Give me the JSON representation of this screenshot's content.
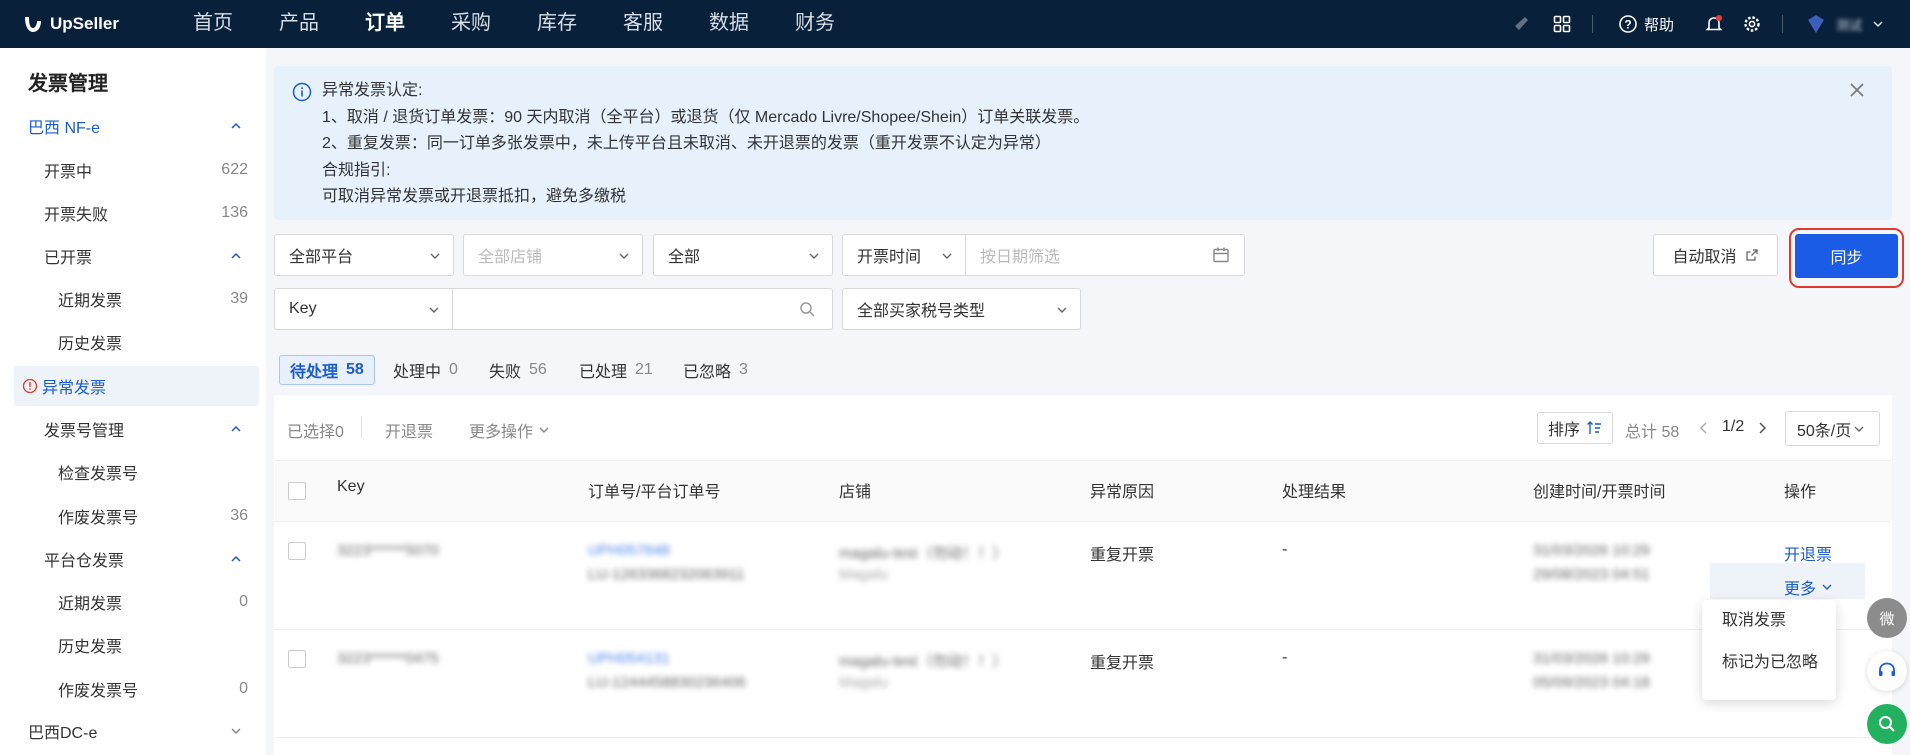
{
  "app": {
    "brand": "UpSeller",
    "user": "测试"
  },
  "nav": [
    "首页",
    "产品",
    "订单",
    "采购",
    "库存",
    "客服",
    "数据",
    "财务"
  ],
  "topbar": {
    "help": "帮助"
  },
  "sidebar": {
    "title": "发票管理",
    "items": [
      {
        "label": "巴西 NF-e",
        "count": ""
      },
      {
        "label": "开票中",
        "count": "622"
      },
      {
        "label": "开票失败",
        "count": "136"
      },
      {
        "label": "已开票",
        "count": ""
      },
      {
        "label": "近期发票",
        "count": "39"
      },
      {
        "label": "历史发票",
        "count": ""
      },
      {
        "label": "异常发票",
        "count": ""
      },
      {
        "label": "发票号管理",
        "count": ""
      },
      {
        "label": "检查发票号",
        "count": ""
      },
      {
        "label": "作废发票号",
        "count": "36"
      },
      {
        "label": "平台仓发票",
        "count": ""
      },
      {
        "label": "近期发票",
        "count": "0"
      },
      {
        "label": "历史发票",
        "count": ""
      },
      {
        "label": "作废发票号",
        "count": "0"
      },
      {
        "label": "巴西DC-e",
        "count": ""
      }
    ]
  },
  "notice": {
    "lines": [
      "异常发票认定:",
      "1、取消 / 退货订单发票：90 天内取消（全平台）或退货（仅 Mercado Livre/Shopee/Shein）订单关联发票。",
      "2、重复发票：同一订单多张发票中，未上传平台且未取消、未开退票的发票（重开发票不认定为异常）",
      "合规指引:",
      "可取消异常发票或开退票抵扣，避免多缴税"
    ]
  },
  "filters": {
    "platform": "全部平台",
    "store": "全部店铺",
    "all": "全部",
    "time_type": "开票时间",
    "date_placeholder": "按日期筛选",
    "key": "Key",
    "key_search_placeholder": "",
    "buyer_tax": "全部买家税号类型",
    "auto_cancel": "自动取消",
    "sync": "同步"
  },
  "tabs": [
    {
      "label": "待处理",
      "count": "58"
    },
    {
      "label": "处理中",
      "count": "0"
    },
    {
      "label": "失败",
      "count": "56"
    },
    {
      "label": "已处理",
      "count": "21"
    },
    {
      "label": "已忽略",
      "count": "3"
    }
  ],
  "toolbar": {
    "selected": "已选择0",
    "refund": "开退票",
    "more_ops": "更多操作",
    "sort": "排序",
    "total": "总计 58",
    "page": "1/2",
    "page_size": "50条/页"
  },
  "columns": [
    "Key",
    "订单号/平台订单号",
    "店铺",
    "异常原因",
    "处理结果",
    "创建时间/开票时间",
    "操作"
  ],
  "rows": [
    {
      "key": "3223******5070",
      "order": "UPH057648",
      "platform_order": "LU-1263368232063911",
      "store": "magalu-test（勿动！！）",
      "store_sub": "Magalu",
      "reason": "重复开票",
      "result": "-",
      "created": "31/03/2026 10:29",
      "issued": "29/08/2023 04:51",
      "action": "开退票",
      "more": "更多"
    },
    {
      "key": "3223******0475",
      "order": "UPH054131",
      "platform_order": "LU-1244458830236406",
      "store": "magalu-test（勿动！！）",
      "store_sub": "Magalu",
      "reason": "重复开票",
      "result": "-",
      "created": "31/03/2026 10:29",
      "issued": "05/09/2023 04:18",
      "action": "",
      "more": ""
    }
  ],
  "more_menu": [
    "取消发票",
    "标记为已忽略"
  ],
  "float": {
    "wechat": "微"
  },
  "colors": {
    "topbar": "#08203a",
    "primary": "#1a5ce6",
    "highlight_ring": "#e03a2e",
    "active_text": "#1b5ccc"
  }
}
